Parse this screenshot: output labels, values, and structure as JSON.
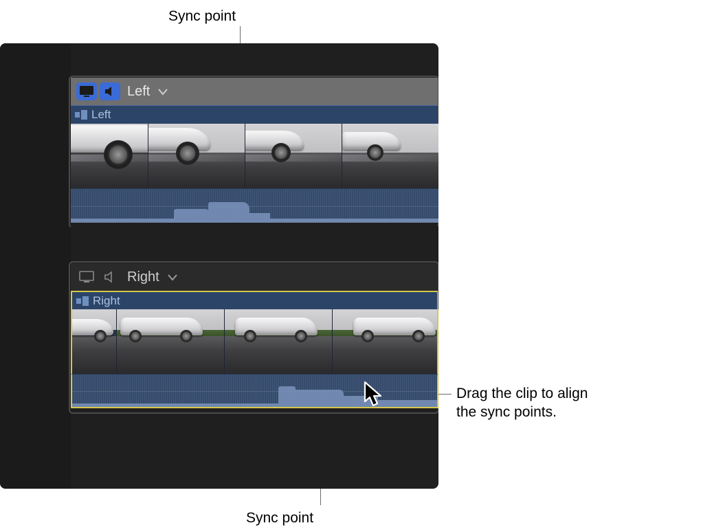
{
  "annotations": {
    "top_sync": "Sync point",
    "bottom_sync": "Sync point",
    "drag_hint_line1": "Drag the clip to align",
    "drag_hint_line2": "the sync points."
  },
  "angles": [
    {
      "name": "Left",
      "clip_label": "Left",
      "active_video": true,
      "active_audio": true
    },
    {
      "name": "Right",
      "clip_label": "Right",
      "active_video": false,
      "active_audio": false
    }
  ],
  "colors": {
    "accent": "#3a6bd6",
    "clip_bg": "#2d4469",
    "selection": "#d8c84a"
  }
}
